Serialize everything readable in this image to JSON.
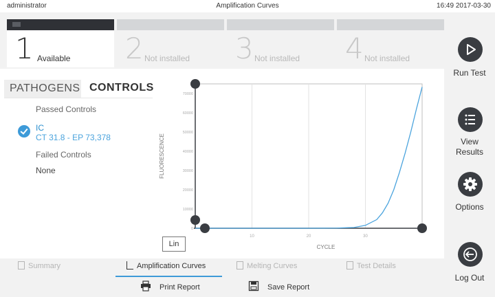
{
  "header": {
    "user": "administrator",
    "title": "Amplification Curves",
    "datetime": "16:49 2017-03-30"
  },
  "modules": [
    {
      "number": "1",
      "label": "Available",
      "tag": "--:--",
      "active": true
    },
    {
      "number": "2",
      "label": "Not installed",
      "active": false
    },
    {
      "number": "3",
      "label": "Not installed",
      "active": false
    },
    {
      "number": "4",
      "label": "Not installed",
      "active": false
    }
  ],
  "result_tabs": {
    "pathogens": "PATHOGENS",
    "controls": "CONTROLS"
  },
  "controls": {
    "passed_heading": "Passed Controls",
    "passed": [
      {
        "name": "IC",
        "detail": "CT 31.8 - EP 73,378"
      }
    ],
    "failed_heading": "Failed Controls",
    "failed_value": "None"
  },
  "scale_button": "Lin",
  "chart_data": {
    "type": "line",
    "xlabel": "CYCLE",
    "ylabel": "FLUORESCENCE",
    "xlim": [
      0,
      40
    ],
    "ylim": [
      0,
      75000
    ],
    "x_ticks": [
      10,
      20,
      30
    ],
    "y_ticks": [
      "70000",
      "60000",
      "50000",
      "40000",
      "30000",
      "20000",
      "10000",
      "0"
    ],
    "grid": true,
    "series": [
      {
        "name": "IC",
        "color": "#4aa3dd",
        "x": [
          0,
          5,
          10,
          15,
          20,
          25,
          28,
          30,
          32,
          33,
          34,
          35,
          36,
          37,
          38,
          39,
          40
        ],
        "y": [
          0,
          0,
          0,
          0,
          0,
          100,
          400,
          1500,
          4500,
          8000,
          13000,
          20000,
          29000,
          39000,
          50000,
          62000,
          73378
        ]
      }
    ]
  },
  "bottom_tabs": [
    {
      "label": "Summary",
      "active": false
    },
    {
      "label": "Amplification Curves",
      "active": true
    },
    {
      "label": "Melting Curves",
      "active": false
    },
    {
      "label": "Test Details",
      "active": false
    }
  ],
  "actions": {
    "print": "Print Report",
    "save": "Save Report"
  },
  "sidebar": {
    "run_test": "Run Test",
    "view_results_1": "View",
    "view_results_2": "Results",
    "options": "Options",
    "log_out": "Log Out"
  },
  "colors": {
    "accent": "#3d9ad8",
    "dark_button": "#3a3d42",
    "curve": "#4aa3dd"
  }
}
